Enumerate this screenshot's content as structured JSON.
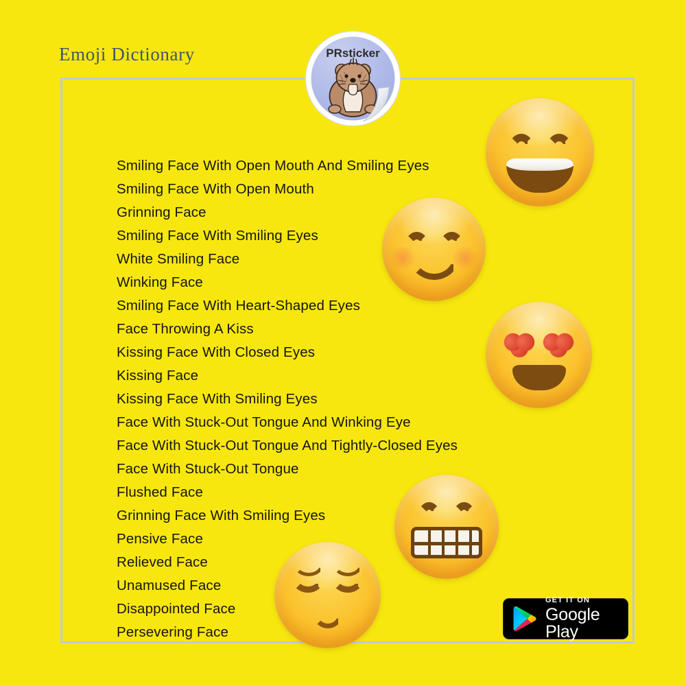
{
  "page": {
    "background_color": "#F7E70E",
    "title": "Emoji Dictionary",
    "title_color": "#3d5569",
    "frame_border_color": "#c2c8d6"
  },
  "logo": {
    "brand": "PRsticker",
    "circle_color": "#a9b4e6",
    "ring_color": "#ffffff",
    "mascot": "hamster-mascot"
  },
  "emoji_list": {
    "items": [
      "Smiling Face With Open Mouth And Smiling Eyes",
      "Smiling Face With Open Mouth",
      "Grinning Face",
      "Smiling Face With Smiling Eyes",
      "White Smiling Face",
      "Winking Face",
      "Smiling Face With Heart-Shaped Eyes",
      "Face Throwing A Kiss",
      "Kissing Face With Closed Eyes",
      "Kissing Face",
      "Kissing Face With Smiling Eyes",
      "Face With Stuck-Out Tongue And Winking Eye",
      "Face With Stuck-Out Tongue And Tightly-Closed Eyes",
      "Face With Stuck-Out Tongue",
      "Flushed Face",
      "Grinning Face With Smiling Eyes",
      "Pensive Face",
      "Relieved Face",
      "Unamused Face",
      "Disappointed Face",
      "Persevering Face"
    ],
    "text_color": "#16150f"
  },
  "emoji_art": [
    {
      "name": "smiling-face-open-mouth-smiling-eyes-emoji",
      "unicode": "😄"
    },
    {
      "name": "smiling-face-with-smiling-eyes-emoji",
      "unicode": "😊"
    },
    {
      "name": "smiling-face-with-heart-eyes-emoji",
      "unicode": "😍"
    },
    {
      "name": "grinning-face-with-smiling-eyes-emoji",
      "unicode": "😁"
    },
    {
      "name": "relieved-face-emoji",
      "unicode": "😌"
    }
  ],
  "google_play_badge": {
    "line1": "GET IT ON",
    "line2": "Google Play",
    "background_color": "#000000",
    "text_color": "#ffffff"
  }
}
